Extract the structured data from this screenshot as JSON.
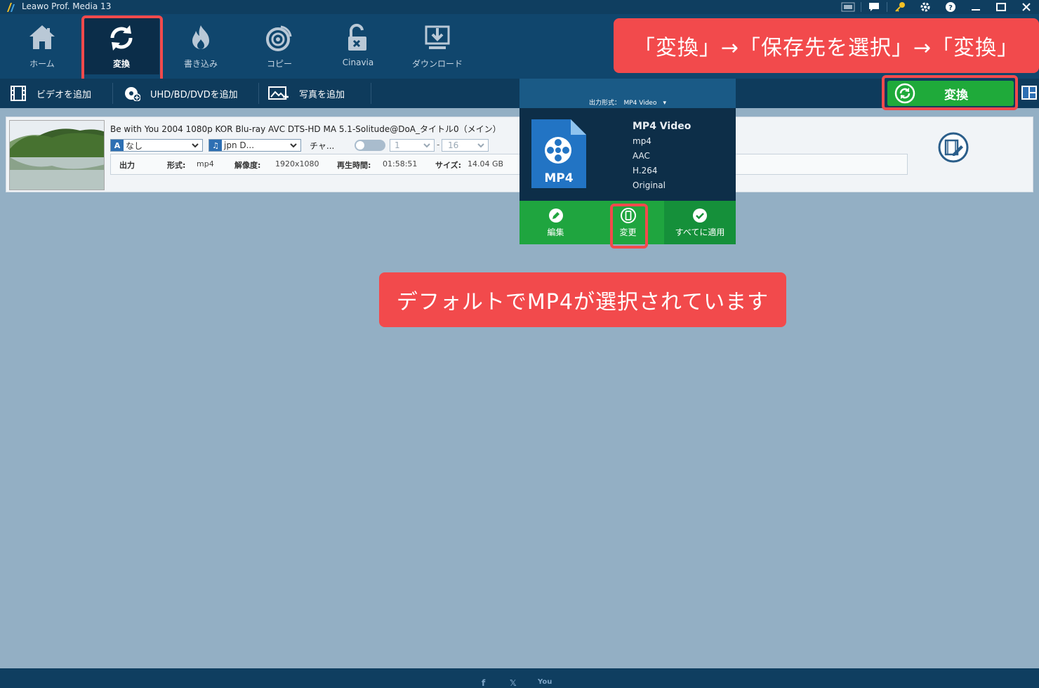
{
  "app": {
    "title": "Leawo Prof. Media 13"
  },
  "window_controls": [
    "amd-icon",
    "chat-icon",
    "key-icon",
    "gear-icon",
    "help-icon",
    "minimize-icon",
    "maximize-icon",
    "close-icon"
  ],
  "toolbar": {
    "items": [
      {
        "label": "ホーム",
        "icon": "home-icon",
        "active": false
      },
      {
        "label": "変換",
        "icon": "convert-icon",
        "active": true
      },
      {
        "label": "書き込み",
        "icon": "burn-icon",
        "active": false
      },
      {
        "label": "コピー",
        "icon": "disc-icon",
        "active": false
      },
      {
        "label": "Cinavia",
        "icon": "unlock-icon",
        "active": false
      },
      {
        "label": "ダウンロード",
        "icon": "download-icon",
        "active": false
      }
    ]
  },
  "subbar": {
    "add_video": "ビデオを追加",
    "add_disc": "UHD/BD/DVDを追加",
    "add_photo": "写真を追加"
  },
  "convert_button": {
    "label": "変換"
  },
  "callouts": {
    "top": "「変換」→「保存先を選択」→「変換」",
    "middle": "デフォルトでMP4が選択されています"
  },
  "file": {
    "title": "Be with You 2004 1080p KOR Blu-ray AVC DTS-HD MA 5.1-Solitude@DoA_タイトル0（メイン）",
    "subtitle_select": "なし",
    "audio_select": "jpn D...",
    "chapter_label": "チャ...",
    "range_start": "1",
    "range_sep": "-",
    "range_end": "16",
    "info": {
      "output_label": "出力",
      "format_key": "形式:",
      "format_val": "mp4",
      "resolution_key": "解像度:",
      "resolution_val": "1920x1080",
      "duration_key": "再生時間:",
      "duration_val": "01:58:51",
      "size_key": "サイズ:",
      "size_val": "14.04 GB"
    }
  },
  "format_popup": {
    "header": "出力形式：　MP4 Video　▾",
    "icon_label": "MP4",
    "name": "MP4 Video",
    "container": "mp4",
    "audio": "AAC",
    "video": "H.264",
    "resolution": "Original",
    "actions": {
      "edit": "編集",
      "change": "変更",
      "apply_all": "すべてに適用"
    }
  },
  "footer": {
    "social": [
      "f",
      "𝕏",
      "You"
    ]
  },
  "colors": {
    "titlebar": "#0f3e60",
    "toolbar": "#10466d",
    "background": "#93afc4",
    "accent_green": "#1faa3a",
    "callout_red": "#f24a4c"
  }
}
